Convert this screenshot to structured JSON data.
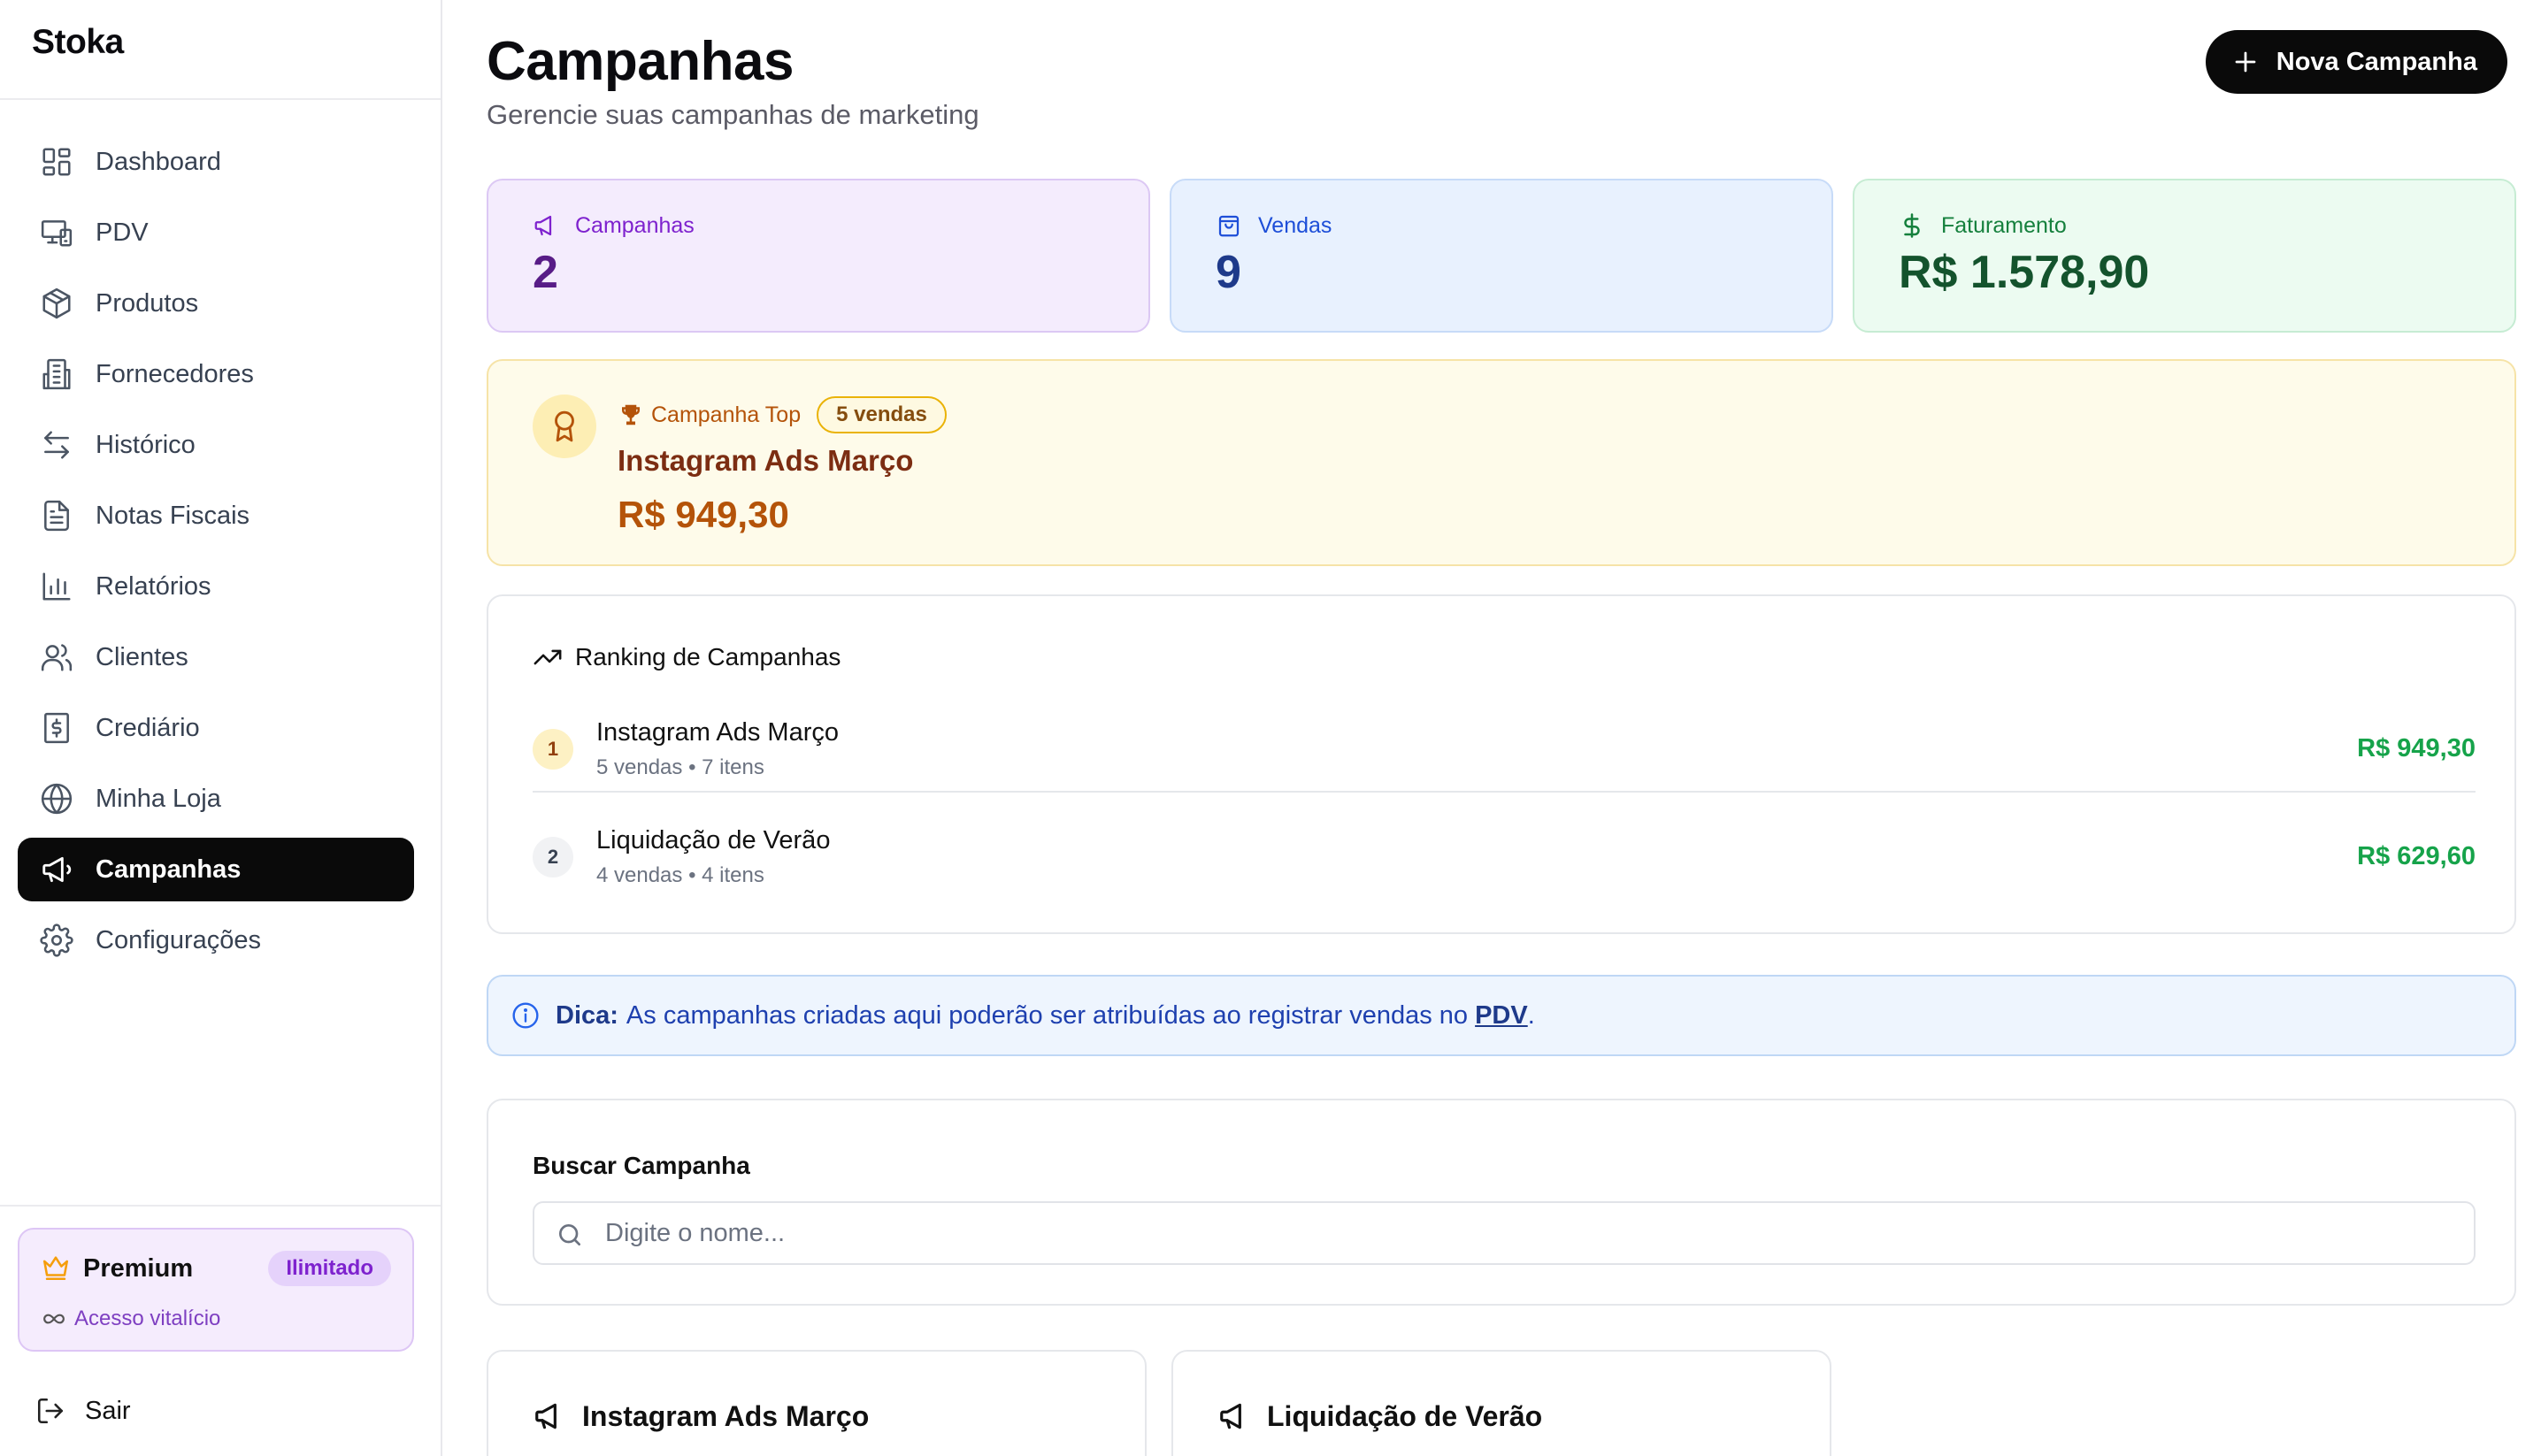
{
  "app": {
    "brand": "Stoka"
  },
  "sidebar": {
    "items": [
      {
        "label": "Dashboard",
        "icon": "dashboard-icon",
        "active": false
      },
      {
        "label": "PDV",
        "icon": "pos-icon",
        "active": false
      },
      {
        "label": "Produtos",
        "icon": "package-icon",
        "active": false
      },
      {
        "label": "Fornecedores",
        "icon": "building-icon",
        "active": false
      },
      {
        "label": "Histórico",
        "icon": "arrows-exchange-icon",
        "active": false
      },
      {
        "label": "Notas Fiscais",
        "icon": "file-text-icon",
        "active": false
      },
      {
        "label": "Relatórios",
        "icon": "bar-chart-icon",
        "active": false
      },
      {
        "label": "Clientes",
        "icon": "users-icon",
        "active": false
      },
      {
        "label": "Crediário",
        "icon": "receipt-dollar-icon",
        "active": false
      },
      {
        "label": "Minha Loja",
        "icon": "globe-icon",
        "active": false
      },
      {
        "label": "Campanhas",
        "icon": "megaphone-icon",
        "active": true
      },
      {
        "label": "Configurações",
        "icon": "gear-icon",
        "active": false
      }
    ],
    "premium": {
      "title": "Premium",
      "badge": "Ilimitado",
      "subtitle": "Acesso vitalício"
    },
    "logout_label": "Sair"
  },
  "header": {
    "title": "Campanhas",
    "subtitle": "Gerencie suas campanhas de marketing",
    "new_button_label": "Nova Campanha"
  },
  "stats": {
    "campaigns": {
      "label": "Campanhas",
      "value": "2"
    },
    "sales": {
      "label": "Vendas",
      "value": "9"
    },
    "revenue": {
      "label": "Faturamento",
      "value": "R$ 1.578,90"
    }
  },
  "top_campaign": {
    "label": "Campanha Top",
    "badge": "5 vendas",
    "name": "Instagram Ads Março",
    "value": "R$ 949,30"
  },
  "ranking": {
    "title": "Ranking de Campanhas",
    "rows": [
      {
        "rank": "1",
        "name": "Instagram Ads Março",
        "meta": "5 vendas • 7 itens",
        "value": "R$ 949,30"
      },
      {
        "rank": "2",
        "name": "Liquidação de Verão",
        "meta": "4 vendas • 4 itens",
        "value": "R$ 629,60"
      }
    ]
  },
  "tip": {
    "strong": "Dica:",
    "text": "As campanhas criadas aqui poderão ser atribuídas ao registrar vendas no",
    "link": "PDV",
    "end": "."
  },
  "search": {
    "label": "Buscar Campanha",
    "placeholder": "Digite o nome...",
    "value": ""
  },
  "campaign_cards": [
    {
      "name": "Instagram Ads Março"
    },
    {
      "name": "Liquidação de Verão"
    }
  ],
  "colors": {
    "accent": "#0a0a0a",
    "campaigns_purple": "#7e22ce",
    "sales_blue": "#1d4ed8",
    "revenue_green": "#15803d",
    "top_amber": "#b45309",
    "ranking_value_green": "#16a34a"
  }
}
